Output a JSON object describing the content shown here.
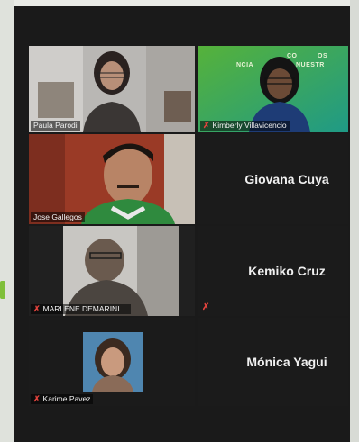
{
  "participants": [
    {
      "name": "Paula Parodi",
      "muted": false
    },
    {
      "name": "Kimberly Villavicencio",
      "muted": true
    },
    {
      "name": "Jose Gallegos",
      "muted": false
    },
    {
      "name": "Giovana Cuya",
      "muted": false
    },
    {
      "name": "MARLENE DEMARINI ...",
      "muted": true
    },
    {
      "name": "Kemiko Cruz",
      "muted": true
    },
    {
      "name": "Karime Pavez",
      "muted": true
    },
    {
      "name": "Mónica Yagui",
      "muted": false
    }
  ],
  "banner": {
    "line1": "CO",
    "line2": "NUESTR",
    "line3": "NCIA",
    "line4": "OS"
  },
  "colors": {
    "active_border": "#c8d640",
    "mic_off": "#e0433d",
    "tile_bg": "#262626"
  },
  "icons": {
    "mic_off": "microphone-muted-icon"
  }
}
